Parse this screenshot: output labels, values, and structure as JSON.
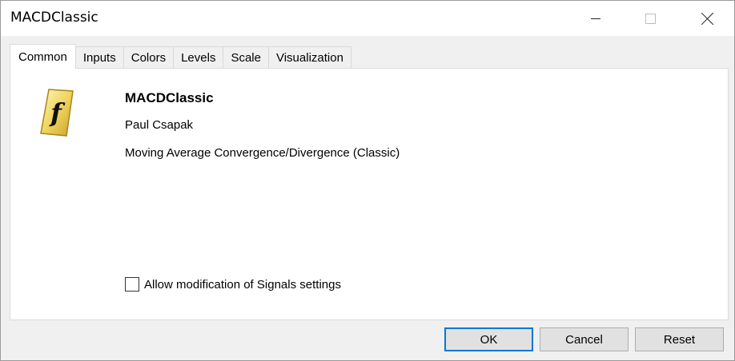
{
  "window": {
    "title": "MACDClassic"
  },
  "tabs": [
    {
      "label": "Common",
      "active": true
    },
    {
      "label": "Inputs",
      "active": false
    },
    {
      "label": "Colors",
      "active": false
    },
    {
      "label": "Levels",
      "active": false
    },
    {
      "label": "Scale",
      "active": false
    },
    {
      "label": "Visualization",
      "active": false
    }
  ],
  "common": {
    "icon": "function-icon",
    "indicator_name": "MACDClassic",
    "author": "Paul Csapak",
    "description": "Moving Average Convergence/Divergence (Classic)",
    "allow_signals_label": "Allow modification of Signals settings",
    "allow_signals_checked": false
  },
  "buttons": {
    "ok": "OK",
    "cancel": "Cancel",
    "reset": "Reset"
  },
  "colors": {
    "accent": "#0078d7",
    "icon_gold": "#e8c84a"
  }
}
